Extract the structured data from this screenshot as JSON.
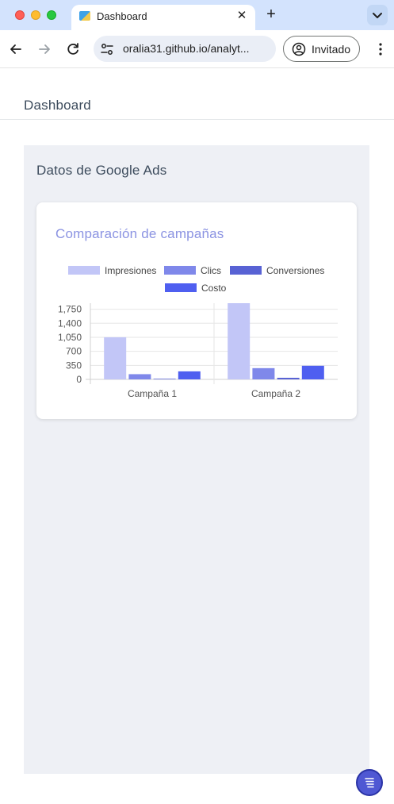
{
  "browser": {
    "tab_title": "Dashboard",
    "url": "oralia31.github.io/analyt...",
    "profile_label": "Invitado"
  },
  "header": {
    "title": "Dashboard"
  },
  "main": {
    "section_title": "Datos de Google Ads"
  },
  "card": {
    "title": "Comparación de campañas"
  },
  "colors": {
    "impresiones": "#c2c6f7",
    "clics": "#7f88ea",
    "conversiones": "#5862d4",
    "costo": "#4f5ff0"
  },
  "chart_data": {
    "type": "bar",
    "categories": [
      "Campaña 1",
      "Campaña 2"
    ],
    "series": [
      {
        "name": "Impresiones",
        "values": [
          1050,
          1900
        ]
      },
      {
        "name": "Clics",
        "values": [
          130,
          280
        ]
      },
      {
        "name": "Conversiones",
        "values": [
          15,
          40
        ]
      },
      {
        "name": "Costo",
        "values": [
          200,
          340
        ]
      }
    ],
    "yticks": [
      "0",
      "350",
      "700",
      "1,050",
      "1,400",
      "1,750"
    ],
    "ylim": [
      0,
      1900
    ],
    "legend_position": "top",
    "grid": true
  }
}
